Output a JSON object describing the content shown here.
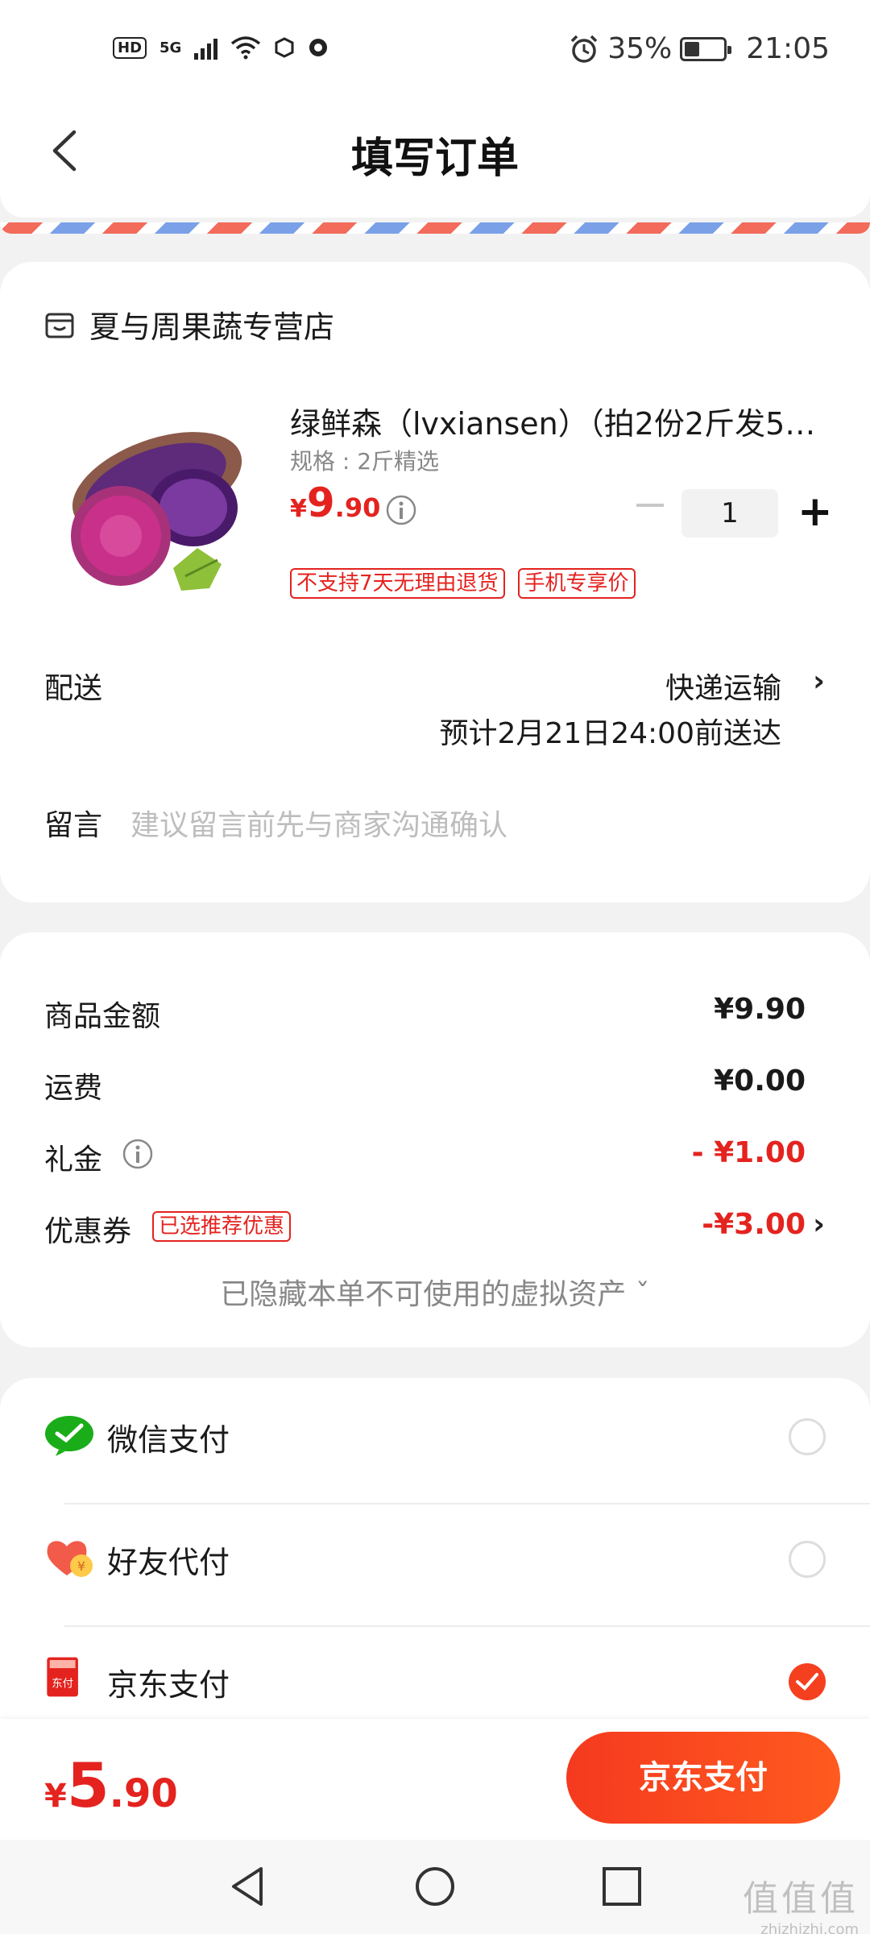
{
  "status_bar": {
    "hd": "HD",
    "network": "5G",
    "battery": "35%",
    "battery_level": 0.35,
    "time": "21:05"
  },
  "header": {
    "title": "填写订单",
    "back_icon": "chevron-left-icon"
  },
  "store": {
    "name": "夏与周果蔬专营店",
    "icon": "store-icon"
  },
  "product": {
    "title": "绿鲜森（lvxiansen）（拍2份2斤发5…",
    "spec": "规格 : 2斤精选",
    "price_currency": "¥",
    "price_int": "9",
    "price_dec": ".90",
    "quantity": "1",
    "tags": [
      "不支持7天无理由退货",
      "手机专享价"
    ]
  },
  "delivery": {
    "label": "配送",
    "mode": "快递运输",
    "eta": "预计2月21日24:00前送达"
  },
  "message": {
    "label": "留言",
    "placeholder": "建议留言前先与商家沟通确认"
  },
  "fees": {
    "goods_label": "商品金额",
    "goods_value": "¥9.90",
    "shipping_label": "运费",
    "shipping_value": "¥0.00",
    "gift_label": "礼金",
    "gift_value": "- ¥1.00",
    "coupon_label": "优惠券",
    "coupon_tag": "已选推荐优惠",
    "coupon_value": "-¥3.00",
    "hidden_assets": "已隐藏本单不可使用的虚拟资产 ˇ"
  },
  "payment_methods": [
    {
      "label": "微信支付",
      "icon": "wechat-pay-icon",
      "selected": false
    },
    {
      "label": "好友代付",
      "icon": "friend-pay-icon",
      "selected": false
    },
    {
      "label": "京东支付",
      "icon": "jd-pay-icon",
      "selected": true
    }
  ],
  "bottom": {
    "total_currency": "¥",
    "total_int": "5",
    "total_dec": ".90",
    "pay_button": "京东支付"
  },
  "watermark": {
    "big": "值值值",
    "small": "zhizhizhi.com"
  },
  "colors": {
    "accent": "#e4231f",
    "button": "#f5401f"
  }
}
